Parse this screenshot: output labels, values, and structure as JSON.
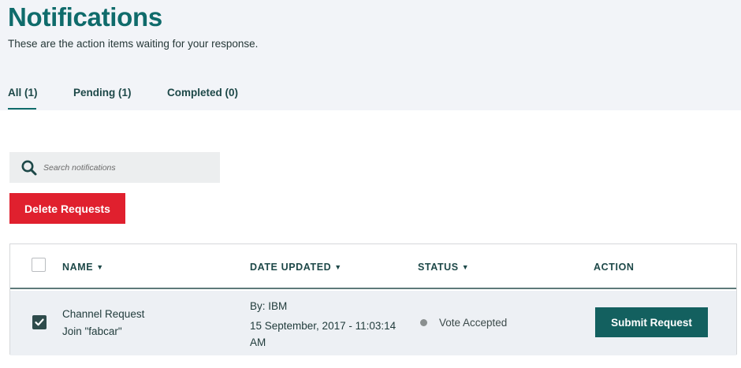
{
  "page": {
    "title": "Notifications",
    "subtitle": "These are the action items waiting for your response."
  },
  "tabs": [
    {
      "label": "All (1)",
      "active": true
    },
    {
      "label": "Pending (1)",
      "active": false
    },
    {
      "label": "Completed (0)",
      "active": false
    }
  ],
  "search": {
    "placeholder": "Search notifications",
    "value": "",
    "icon": "search-icon"
  },
  "toolbar": {
    "delete_label": "Delete Requests"
  },
  "table": {
    "columns": [
      {
        "label": "NAME",
        "sortable": true
      },
      {
        "label": "DATE UPDATED",
        "sortable": true
      },
      {
        "label": "STATUS",
        "sortable": true
      },
      {
        "label": "ACTION",
        "sortable": false
      }
    ],
    "header_checked": false,
    "rows": [
      {
        "checked": true,
        "name": "Channel Request",
        "detail": "Join \"fabcar\"",
        "by": "By: IBM",
        "date": "15 September, 2017 - 11:03:14 AM",
        "status": "Vote Accepted",
        "action_label": "Submit Request"
      }
    ]
  },
  "colors": {
    "brand": "#0f6b6b",
    "danger": "#e0202e",
    "primary_button": "#13605f",
    "header_bg": "#f2f4f8",
    "row_bg": "#edf0f4"
  }
}
